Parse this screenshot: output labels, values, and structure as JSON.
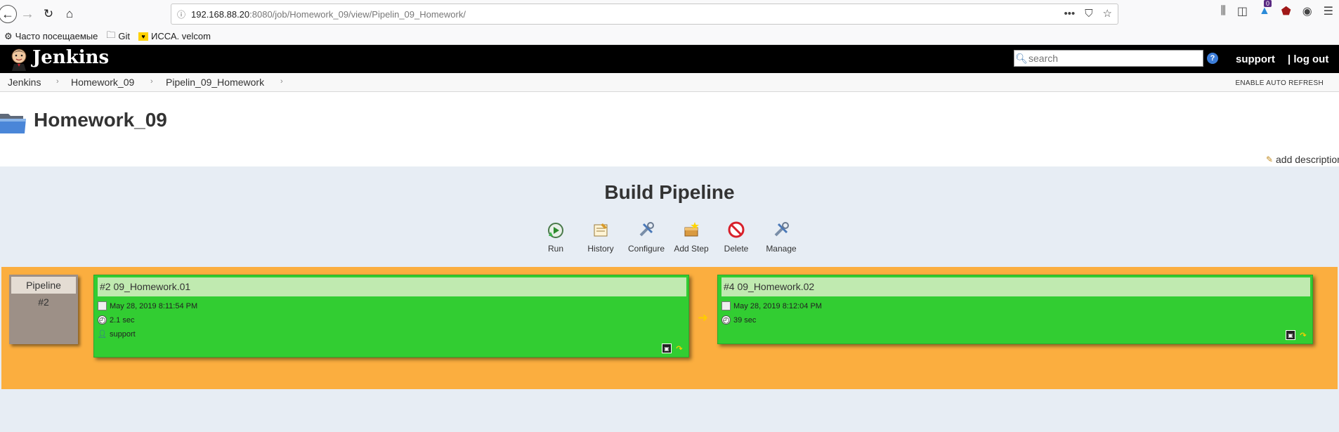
{
  "browser": {
    "url_host": "192.168.88.20",
    "url_rest": ":8080/job/Homework_09/view/Pipelin_09_Homework/",
    "badge_count": "0",
    "bookmarks": [
      {
        "label": "Часто посещаемые",
        "icon": "gear-icon"
      },
      {
        "label": "Git",
        "icon": "folder-icon"
      },
      {
        "label": "ИССА. velcom",
        "icon": "velcom-logo"
      }
    ]
  },
  "header": {
    "title": "Jenkins",
    "search_placeholder": "search",
    "help": "?",
    "support": "support",
    "logout": "| log out"
  },
  "breadcrumb": {
    "items": [
      "Jenkins",
      "Homework_09",
      "Pipelin_09_Homework"
    ],
    "separator": "›",
    "auto_refresh": "ENABLE AUTO REFRESH"
  },
  "page": {
    "title": "Homework_09",
    "add_description": "add description"
  },
  "pipeline": {
    "title": "Build Pipeline",
    "actions": [
      {
        "label": "Run",
        "icon": "run-icon"
      },
      {
        "label": "History",
        "icon": "history-icon"
      },
      {
        "label": "Configure",
        "icon": "configure-icon"
      },
      {
        "label": "Add Step",
        "icon": "add-step-icon"
      },
      {
        "label": "Delete",
        "icon": "delete-icon"
      },
      {
        "label": "Manage",
        "icon": "manage-icon"
      }
    ],
    "head_label": "Pipeline",
    "head_number": "#2",
    "builds": [
      {
        "title": "#2 09_Homework.01",
        "date": "May 28, 2019 8:11:54 PM",
        "duration": "2.1 sec",
        "user": "support",
        "status_color": "#32cd32"
      },
      {
        "title": "#4 09_Homework.02",
        "date": "May 28, 2019 8:12:04 PM",
        "duration": "39 sec",
        "status_color": "#32cd32"
      }
    ],
    "colors": {
      "stage": "#fbae3f",
      "success": "#32cd32",
      "background": "#e7edf4"
    }
  }
}
